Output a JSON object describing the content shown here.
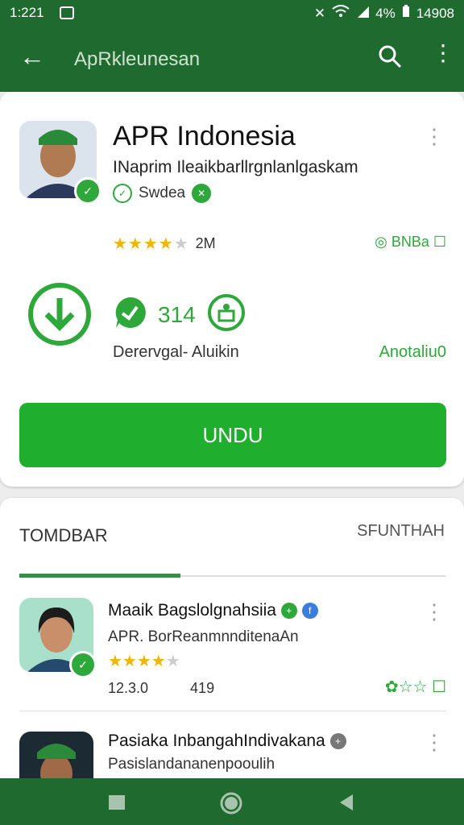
{
  "status_bar": {
    "time": "1:221",
    "right_text": "4%",
    "clock": "14908"
  },
  "app_bar": {
    "title": "ApRkleunesan"
  },
  "app": {
    "name": "APR Indonesia",
    "subtitle": "INaprim Ileaikbarllrgnlanlgaskam",
    "tag": "Swdea",
    "rating_count": "2M",
    "rank_label": "BNBa",
    "stat_count": "314",
    "description_left": "Derervgal- Aluikin",
    "description_right": "Anotaliu0",
    "install_label": "UNDU"
  },
  "section": {
    "title": "TOMDBAR",
    "link": "SFUNTHAH"
  },
  "list": [
    {
      "title": "Maaik Bagslolgnahsiia",
      "subtitle": "APR. BorReanmnnditenaAn",
      "version": "12.3.0",
      "size": "419"
    },
    {
      "title": "Pasiaka InbangahIndivakana",
      "subtitle": "Pasislandananenpooulih"
    }
  ],
  "colors": {
    "primary_dark": "#1f6b2f",
    "accent": "#2ea83a",
    "install": "#1fae2e",
    "star": "#f2b400"
  }
}
